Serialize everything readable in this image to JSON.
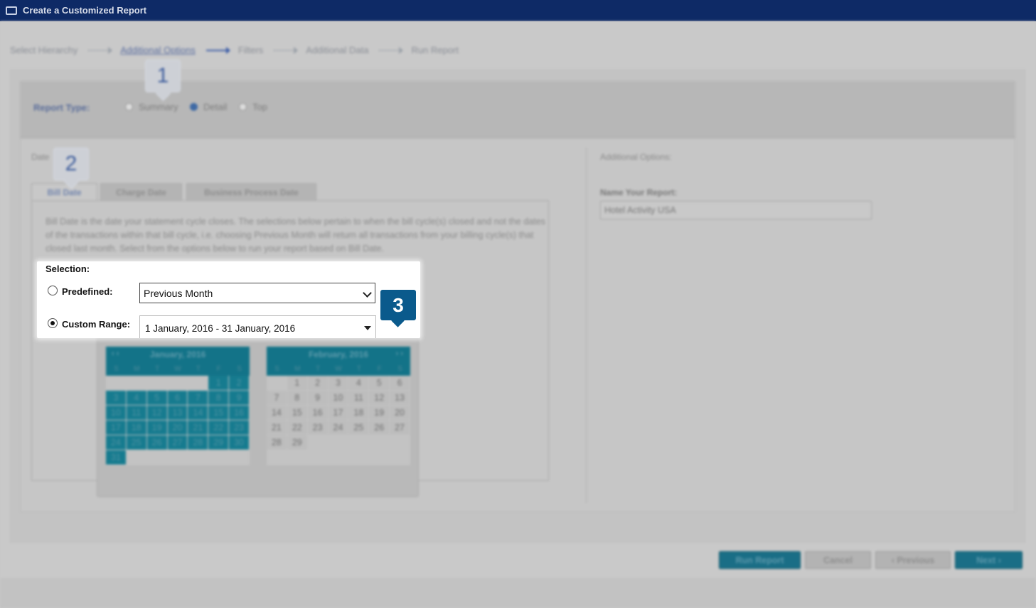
{
  "window": {
    "title": "Create a Customized Report"
  },
  "wizard": {
    "steps": [
      "Select Hierarchy",
      "Additional Options",
      "Filters",
      "Additional Data",
      "Run Report"
    ]
  },
  "report_type": {
    "label": "Report Type:",
    "options": [
      "Summary",
      "Detail",
      "Top"
    ],
    "selected": "Detail"
  },
  "date_section": {
    "label": "Date",
    "tabs": [
      "Bill Date",
      "Charge Date",
      "Business Process Date"
    ],
    "active_tab": "Bill Date",
    "description": "Bill Date is the date your statement cycle closes. The selections below pertain to when the bill cycle(s) closed and not the dates of the transactions within that bill cycle, i.e. choosing Previous Month will return all transactions from your billing cycle(s) that closed last month. Select from the options below to run your report based on Bill Date."
  },
  "selection": {
    "label": "Selection:",
    "predefined_label": "Predefined:",
    "predefined_value": "Previous Month",
    "custom_label": "Custom Range:",
    "custom_value": "1 January, 2016 - 31 January, 2016",
    "selected_option": "Custom Range"
  },
  "calendars": [
    {
      "title": "January, 2016",
      "dow": [
        "S",
        "M",
        "T",
        "W",
        "T",
        "F",
        "S"
      ],
      "weeks": [
        [
          "",
          "",
          "",
          "",
          "",
          "1",
          "2"
        ],
        [
          "3",
          "4",
          "5",
          "6",
          "7",
          "8",
          "9"
        ],
        [
          "10",
          "11",
          "12",
          "13",
          "14",
          "15",
          "16"
        ],
        [
          "17",
          "18",
          "19",
          "20",
          "21",
          "22",
          "23"
        ],
        [
          "24",
          "25",
          "26",
          "27",
          "28",
          "29",
          "30"
        ],
        [
          "31",
          "",
          "",
          "",
          "",
          "",
          ""
        ]
      ]
    },
    {
      "title": "February, 2016",
      "dow": [
        "S",
        "M",
        "T",
        "W",
        "T",
        "F",
        "S"
      ],
      "weeks": [
        [
          "",
          "1",
          "2",
          "3",
          "4",
          "5",
          "6"
        ],
        [
          "7",
          "8",
          "9",
          "10",
          "11",
          "12",
          "13"
        ],
        [
          "14",
          "15",
          "16",
          "17",
          "18",
          "19",
          "20"
        ],
        [
          "21",
          "22",
          "23",
          "24",
          "25",
          "26",
          "27"
        ],
        [
          "28",
          "29",
          "",
          "",
          "",
          "",
          ""
        ],
        [
          "",
          "",
          "",
          "",
          "",
          "",
          ""
        ]
      ]
    }
  ],
  "additional_options": {
    "label": "Additional Options:",
    "name_label": "Name Your Report:",
    "name_value": "Hotel Activity USA"
  },
  "buttons": {
    "run": "Run Report",
    "cancel": "Cancel",
    "previous": "‹ Previous",
    "next": "Next ›"
  },
  "callouts": [
    "1",
    "2",
    "3"
  ],
  "colors": {
    "title_bar": "#0e2a66",
    "accent_teal": "#137388",
    "callout_blue": "#0a5a8c"
  }
}
